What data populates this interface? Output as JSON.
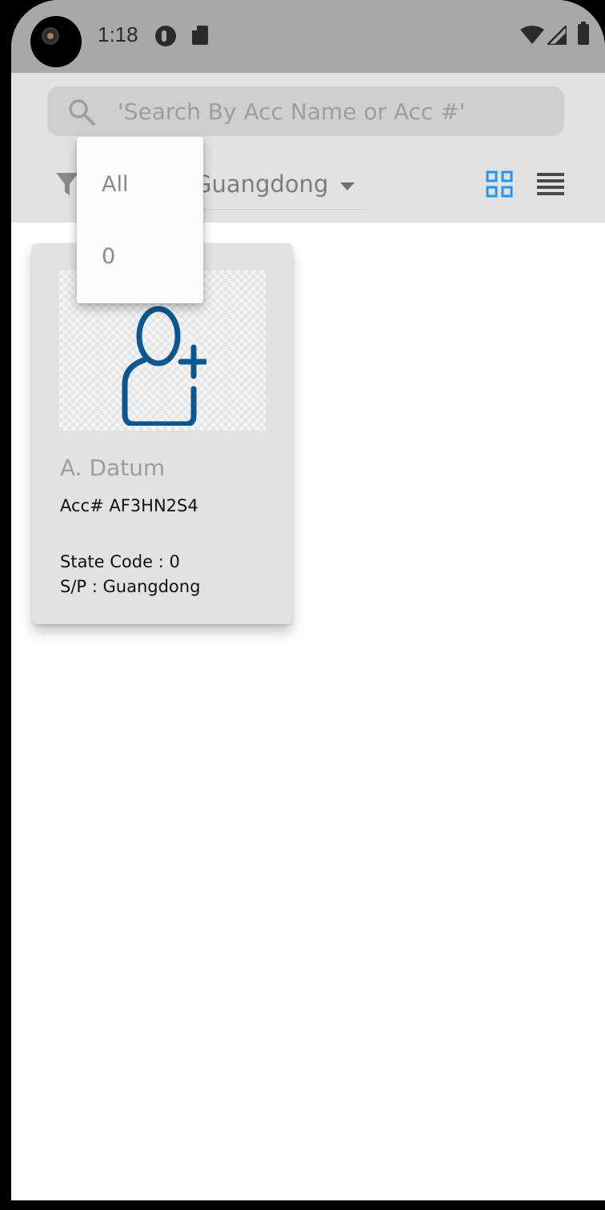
{
  "status_bar": {
    "time": "1:18",
    "icons": [
      "data-saver-icon",
      "sd-card-icon",
      "wifi-icon",
      "signal-icon",
      "battery-icon"
    ]
  },
  "search": {
    "placeholder": "'Search By Acc Name or Acc #'",
    "value": ""
  },
  "filter": {
    "selected_state": "Guangdong"
  },
  "view_toggle": {
    "active": "grid",
    "active_color": "#2196f3"
  },
  "state_menu": {
    "options": [
      "All",
      "0"
    ]
  },
  "accounts": [
    {
      "name": "A. Datum",
      "acc_line": "Acc# AF3HN2S4",
      "state_line": "State Code : 0",
      "sp_line": "S/P : Guangdong"
    }
  ],
  "colors": {
    "status_bar": "#a8a8a8",
    "header": "#e2e2e2",
    "icon_blue": "#0d5790"
  }
}
